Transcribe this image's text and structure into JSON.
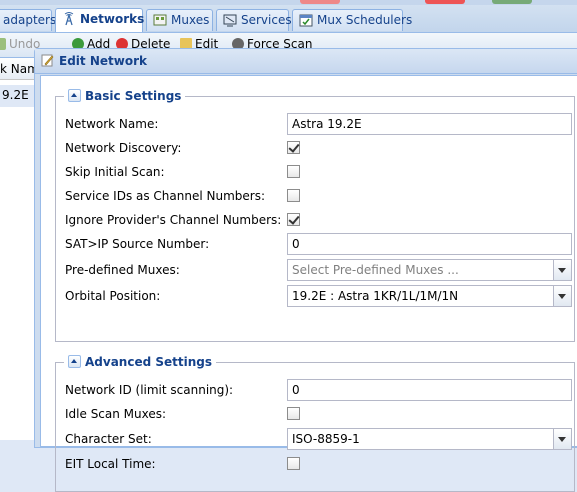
{
  "tabs": [
    {
      "label": "adapters",
      "icon": "adapter-icon"
    },
    {
      "label": "Networks",
      "icon": "antenna-icon",
      "active": true
    },
    {
      "label": "Muxes",
      "icon": "mux-icon"
    },
    {
      "label": "Services",
      "icon": "tv-icon"
    },
    {
      "label": "Mux Schedulers",
      "icon": "scheduler-icon"
    }
  ],
  "toolbar": {
    "undo_label": "Undo",
    "add_label": "Add",
    "delete_label": "Delete",
    "edit_label": "Edit",
    "force_scan_label": "Force Scan"
  },
  "grid": {
    "column_header": "k Name",
    "row_value": "9.2E"
  },
  "dialog": {
    "title": "Edit Network",
    "basic": {
      "legend": "Basic Settings",
      "network_name_label": "Network Name:",
      "network_name_value": "Astra 19.2E",
      "network_discovery_label": "Network Discovery:",
      "network_discovery_checked": true,
      "skip_initial_scan_label": "Skip Initial Scan:",
      "skip_initial_scan_checked": false,
      "service_ids_label": "Service IDs as Channel Numbers:",
      "service_ids_checked": false,
      "ignore_provider_label": "Ignore Provider's Channel Numbers:",
      "ignore_provider_checked": true,
      "satip_label": "SAT>IP Source Number:",
      "satip_value": "0",
      "predefined_label": "Pre-defined Muxes:",
      "predefined_placeholder": "Select Pre-defined Muxes ...",
      "orbital_label": "Orbital Position:",
      "orbital_value": "19.2E : Astra 1KR/1L/1M/1N"
    },
    "advanced": {
      "legend": "Advanced Settings",
      "network_id_label": "Network ID (limit scanning):",
      "network_id_value": "0",
      "idle_scan_label": "Idle Scan Muxes:",
      "idle_scan_checked": false,
      "charset_label": "Character Set:",
      "charset_value": "ISO-8859-1",
      "eit_label": "EIT Local Time:",
      "eit_checked": false
    }
  },
  "colors": {
    "accent": "#15428b",
    "border": "#99bbe8",
    "background": "#dfe8f6"
  }
}
